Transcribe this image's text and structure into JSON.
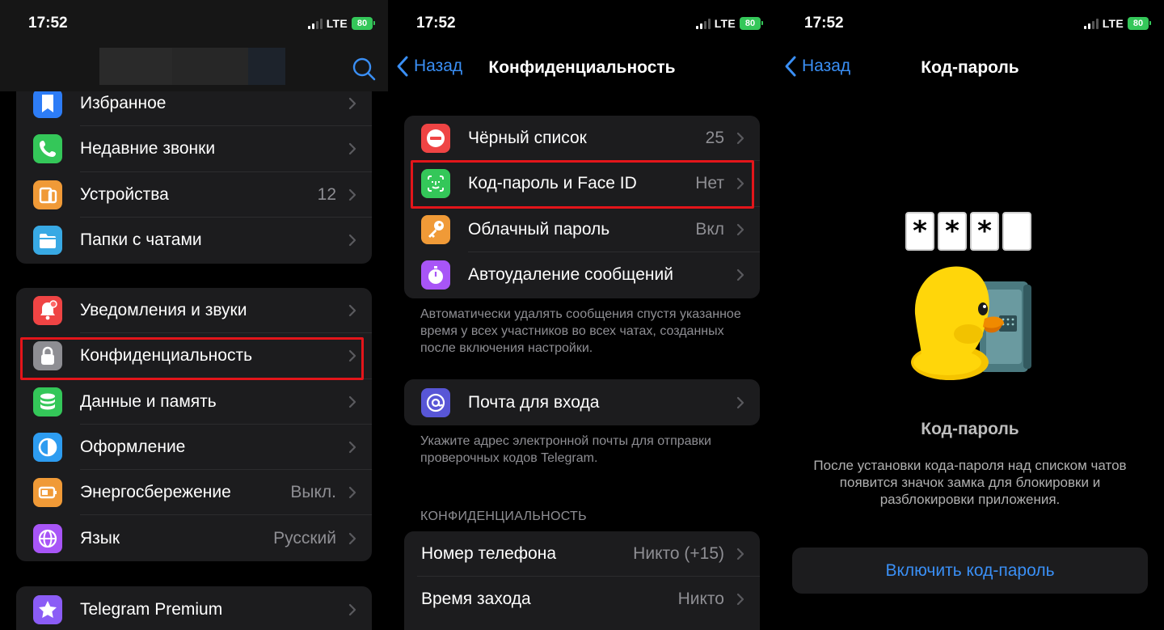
{
  "status": {
    "time": "17:52",
    "network": "LTE",
    "battery": "80"
  },
  "panel1": {
    "group1": [
      {
        "label": "Избранное",
        "value": "",
        "icon": "bookmark-icon",
        "color": "#2d7cf6"
      },
      {
        "label": "Недавние звонки",
        "value": "",
        "icon": "phone-icon",
        "color": "#34c759"
      },
      {
        "label": "Устройства",
        "value": "12",
        "icon": "devices-icon",
        "color": "#f09a37"
      },
      {
        "label": "Папки с чатами",
        "value": "",
        "icon": "folder-icon",
        "color": "#38a9e4"
      }
    ],
    "group2": [
      {
        "label": "Уведомления и звуки",
        "value": "",
        "icon": "bell-icon",
        "color": "#ef4444"
      },
      {
        "label": "Конфиденциальность",
        "value": "",
        "icon": "lock-icon",
        "color": "#8e8e93"
      },
      {
        "label": "Данные и память",
        "value": "",
        "icon": "database-icon",
        "color": "#34c759"
      },
      {
        "label": "Оформление",
        "value": "",
        "icon": "theme-icon",
        "color": "#2d9cf0"
      },
      {
        "label": "Энергосбережение",
        "value": "Выкл.",
        "icon": "battery-saver-icon",
        "color": "#f09a37"
      },
      {
        "label": "Язык",
        "value": "Русский",
        "icon": "globe-icon",
        "color": "#a855f7"
      }
    ],
    "group3": [
      {
        "label": "Telegram Premium",
        "value": "",
        "icon": "star-icon",
        "color": "#8b5cf6"
      }
    ]
  },
  "panel2": {
    "back": "Назад",
    "title": "Конфиденциальность",
    "group1": [
      {
        "label": "Чёрный список",
        "value": "25",
        "icon": "block-icon",
        "color": "#ef4444"
      },
      {
        "label": "Код-пароль и Face ID",
        "value": "Нет",
        "icon": "faceid-icon",
        "color": "#34c759"
      },
      {
        "label": "Облачный пароль",
        "value": "Вкл",
        "icon": "key-icon",
        "color": "#f09a37"
      },
      {
        "label": "Автоудаление сообщений",
        "value": "",
        "icon": "timer-icon",
        "color": "#a855f7"
      }
    ],
    "footnote1": "Автоматически удалять сообщения спустя указанное время у всех участников во всех чатах, созданных после включения настройки.",
    "group2": [
      {
        "label": "Почта для входа",
        "value": "",
        "icon": "at-icon",
        "color": "#5856d6"
      }
    ],
    "footnote2": "Укажите адрес электронной почты для отправки проверочных кодов Telegram.",
    "section_header": "КОНФИДЕНЦИАЛЬНОСТЬ",
    "group3": [
      {
        "label": "Номер телефона",
        "value": "Никто (+15)"
      },
      {
        "label": "Время захода",
        "value": "Никто"
      }
    ]
  },
  "panel3": {
    "back": "Назад",
    "title": "Код-пароль",
    "pin": [
      "*",
      "*",
      "*",
      ""
    ],
    "heading": "Код-пароль",
    "description": "После установки кода-пароля над списком чатов появится значок замка для блокировки и разблокировки приложения.",
    "button": "Включить код-пароль"
  }
}
